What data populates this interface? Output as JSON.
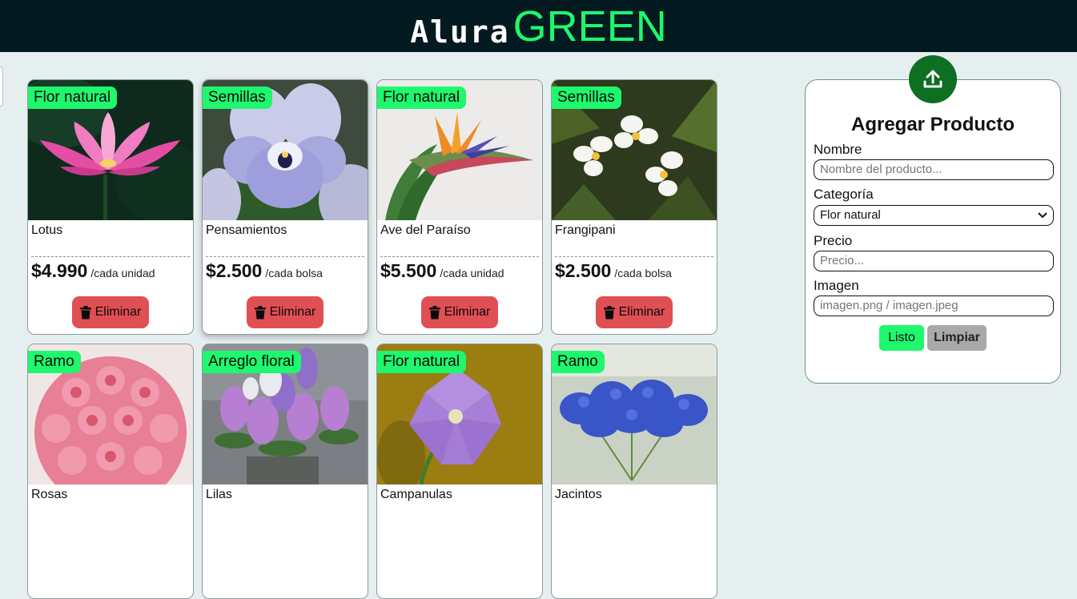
{
  "header": {
    "brand_part1": "Alura",
    "brand_part2": "GREEN"
  },
  "colors": {
    "header_bg": "#031a21",
    "brand_green": "#1ef76e",
    "badge_bg": "#1ef76e",
    "delete_button": "#e04f53",
    "upload_button": "#0e6e22",
    "clear_button": "#a9a9a9",
    "page_bg": "#e6eff0"
  },
  "products": [
    {
      "category": "Flor natural",
      "name": "Lotus",
      "price": "$4.990",
      "unit": "/cada unidad",
      "delete_label": "Eliminar",
      "image": "lotus-flower"
    },
    {
      "category": "Semillas",
      "name": "Pensamientos",
      "price": "$2.500",
      "unit": "/cada bolsa",
      "delete_label": "Eliminar",
      "image": "pansy-flower"
    },
    {
      "category": "Flor natural",
      "name": "Ave del Paraíso",
      "price": "$5.500",
      "unit": "/cada unidad",
      "delete_label": "Eliminar",
      "image": "bird-of-paradise-flower"
    },
    {
      "category": "Semillas",
      "name": "Frangipani",
      "price": "$2.500",
      "unit": "/cada bolsa",
      "delete_label": "Eliminar",
      "image": "frangipani-flower"
    },
    {
      "category": "Ramo",
      "name": "Rosas",
      "image": "rose-bouquet"
    },
    {
      "category": "Arreglo floral",
      "name": "Lilas",
      "image": "lilac-arrangement"
    },
    {
      "category": "Flor natural",
      "name": "Campanulas",
      "image": "campanula-flower"
    },
    {
      "category": "Ramo",
      "name": "Jacintos",
      "image": "hyacinth-bouquet"
    }
  ],
  "form": {
    "upload_icon": "upload-icon",
    "title": "Agregar Producto",
    "name_label": "Nombre",
    "name_placeholder": "Nombre del producto...",
    "category_label": "Categoría",
    "category_value": "Flor natural",
    "price_label": "Precio",
    "price_placeholder": "Precio...",
    "image_label": "Imagen",
    "image_placeholder": "imagen.png / imagen.jpeg",
    "submit_label": "Listo",
    "clear_label": "Limpiar"
  }
}
